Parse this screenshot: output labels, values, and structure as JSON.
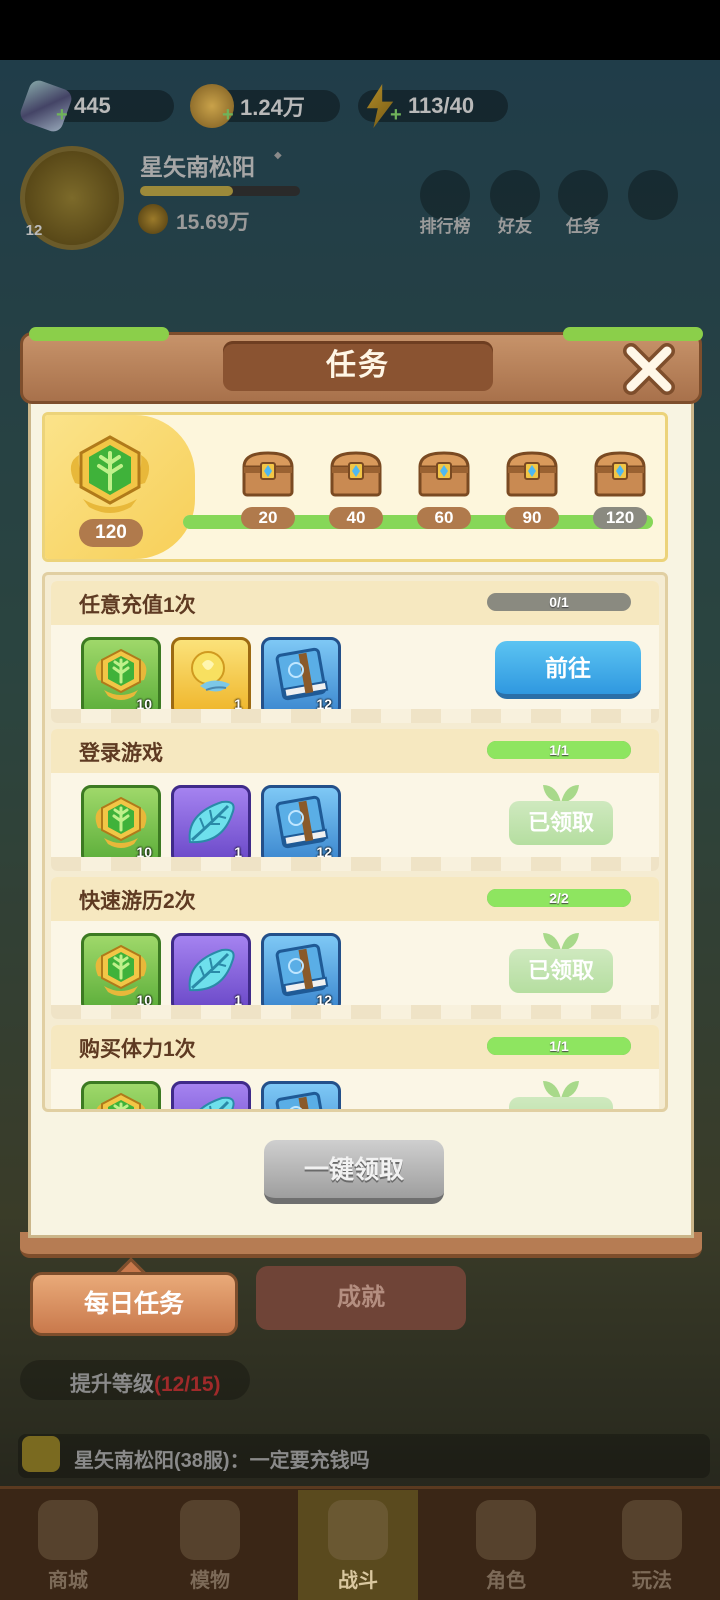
{
  "resources": {
    "gems": "445",
    "gold": "1.24万",
    "energy": "113/40"
  },
  "profile": {
    "level": "12",
    "name": "星矢南松阳",
    "power": "15.69万",
    "exp_fraction": 0.58
  },
  "top_menu": [
    {
      "label": "排行榜",
      "icon": "leaderboard-icon"
    },
    {
      "label": "好友",
      "icon": "friends-icon"
    },
    {
      "label": "任务",
      "icon": "tasks-icon"
    },
    {
      "label": "",
      "icon": "more-icon"
    }
  ],
  "panel": {
    "title": "任务",
    "activity": {
      "current": "120",
      "progress_fraction": 1.0,
      "milestones": [
        "20",
        "40",
        "60",
        "90",
        "120"
      ]
    },
    "tasks": [
      {
        "title": "任意充值1次",
        "progress": "0/1",
        "progress_fraction": 0,
        "rewards": [
          {
            "type": "activity-emblem",
            "style": "green",
            "qty": "10"
          },
          {
            "type": "golden-feather",
            "style": "gold",
            "qty": "1"
          },
          {
            "type": "blue-book",
            "style": "blue",
            "qty": "12"
          }
        ],
        "action": "前往",
        "state": "goto"
      },
      {
        "title": "登录游戏",
        "progress": "1/1",
        "progress_fraction": 1,
        "rewards": [
          {
            "type": "activity-emblem",
            "style": "green",
            "qty": "10"
          },
          {
            "type": "blue-leaf",
            "style": "purple",
            "qty": "1"
          },
          {
            "type": "blue-book",
            "style": "blue",
            "qty": "12"
          }
        ],
        "action": "已领取",
        "state": "claimed"
      },
      {
        "title": "快速游历2次",
        "progress": "2/2",
        "progress_fraction": 1,
        "rewards": [
          {
            "type": "activity-emblem",
            "style": "green",
            "qty": "10"
          },
          {
            "type": "blue-leaf",
            "style": "purple",
            "qty": "1"
          },
          {
            "type": "blue-book",
            "style": "blue",
            "qty": "12"
          }
        ],
        "action": "已领取",
        "state": "claimed"
      },
      {
        "title": "购买体力1次",
        "progress": "1/1",
        "progress_fraction": 1,
        "rewards": [
          {
            "type": "activity-emblem",
            "style": "green",
            "qty": ""
          },
          {
            "type": "blue-leaf",
            "style": "purple",
            "qty": ""
          },
          {
            "type": "blue-book",
            "style": "blue",
            "qty": ""
          }
        ],
        "action": "",
        "state": "claimed"
      }
    ],
    "claim_all_label": "一键领取"
  },
  "tabs": {
    "daily": "每日任务",
    "achievement": "成就"
  },
  "level_up": {
    "label": "提升等级",
    "count": "(12/15)"
  },
  "chat": {
    "message": "星矢南松阳(38服)：一定要充钱吗"
  },
  "bottom_nav": [
    {
      "label": "商城"
    },
    {
      "label": "模物"
    },
    {
      "label": "战斗"
    },
    {
      "label": "角色"
    },
    {
      "label": "玩法"
    }
  ],
  "colors": {
    "accent_blue": "#3aa8ea",
    "progress_green": "#86d758",
    "panel_brown": "#a8714b",
    "title_text": "#5e3a22"
  }
}
